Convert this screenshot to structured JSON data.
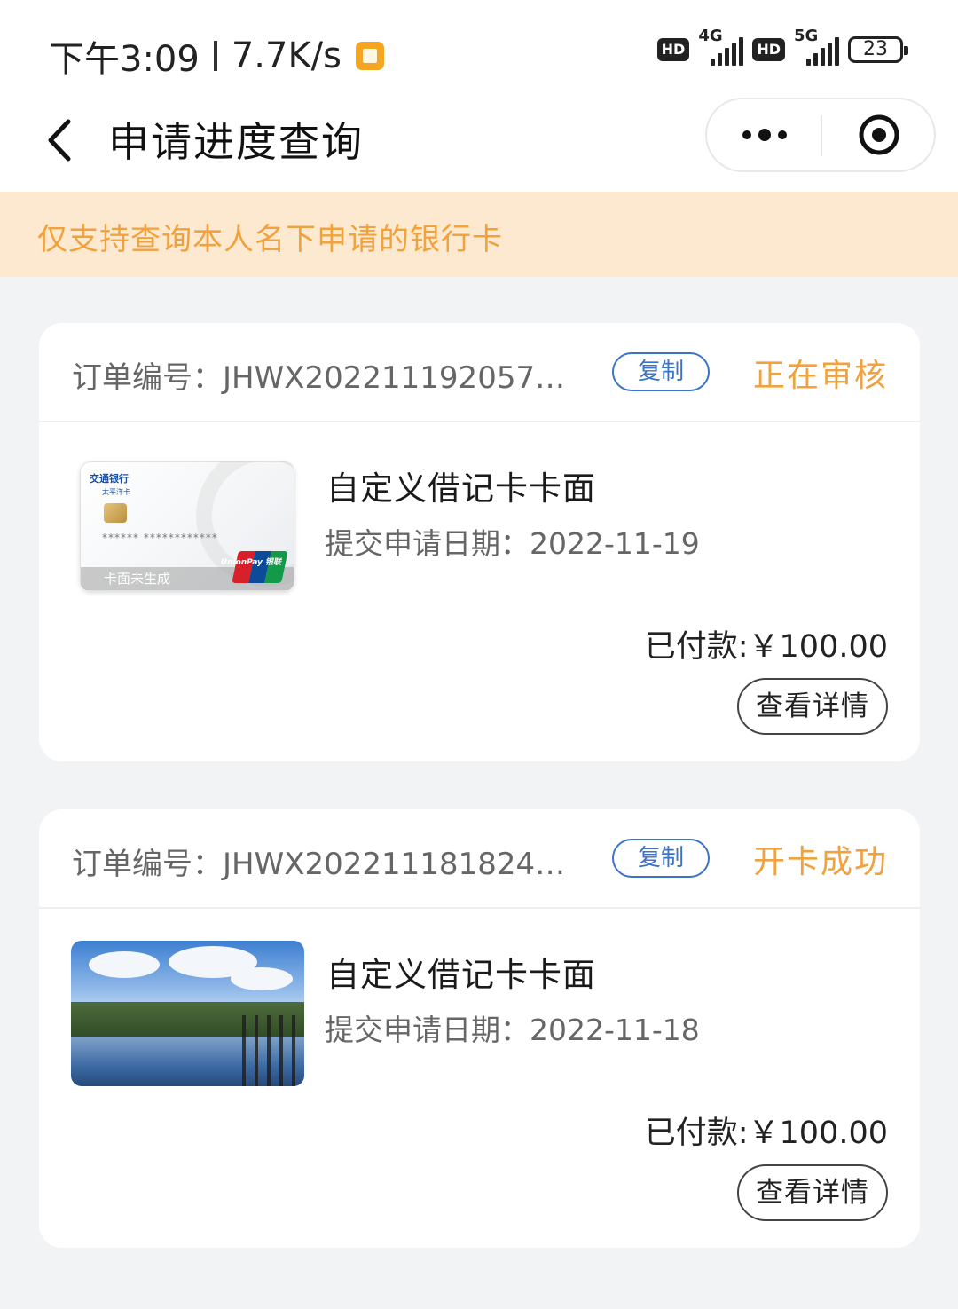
{
  "status_bar": {
    "time": "下午3:09",
    "net_speed": "7.7K/s",
    "sim1_label": "HD",
    "sim1_network": "4G",
    "sim2_label": "HD",
    "sim2_network": "5G",
    "battery": "23"
  },
  "nav": {
    "title": "申请进度查询"
  },
  "notice": {
    "text": "仅支持查询本人名下申请的银行卡"
  },
  "orders": [
    {
      "order_label": "订单编号：JHWX2022111920574…",
      "copy_label": "复制",
      "status": "正在审核",
      "card_face": {
        "bank_name": "交通银行",
        "card_subtitle": "太平洋卡",
        "masked_number": "****** ************",
        "footer_text": "卡面未生成",
        "network_logo": "UnionPay 银联"
      },
      "title": "自定义借记卡卡面",
      "submit_date": "提交申请日期：2022-11-19",
      "paid": "已付款:￥100.00",
      "detail_label": "查看详情"
    },
    {
      "order_label": "订单编号：JHWX2022111818243…",
      "copy_label": "复制",
      "status": "开卡成功",
      "title": "自定义借记卡卡面",
      "submit_date": "提交申请日期：2022-11-18",
      "paid": "已付款:￥100.00",
      "detail_label": "查看详情"
    }
  ],
  "colors": {
    "accent_orange": "#f0a23e",
    "notice_bg": "#fde9cf",
    "copy_blue": "#3b73c8",
    "page_bg": "#f2f3f5"
  }
}
